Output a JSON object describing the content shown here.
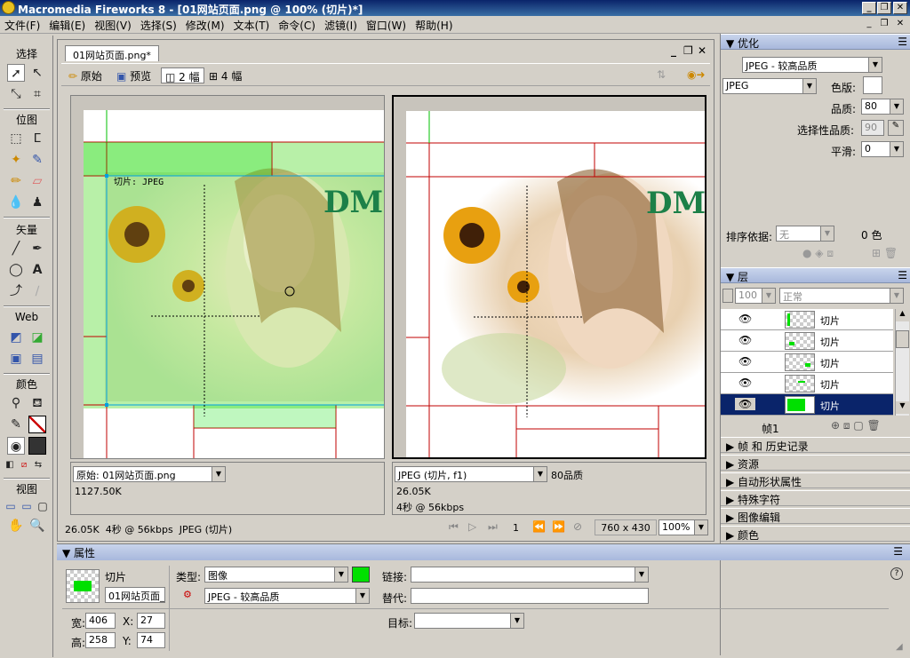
{
  "app": {
    "title": "Macromedia Fireworks 8 - [01网站页面.png @ 100% (切片)*]"
  },
  "menu": [
    "文件(F)",
    "编辑(E)",
    "视图(V)",
    "选择(S)",
    "修改(M)",
    "文本(T)",
    "命令(C)",
    "滤镜(I)",
    "窗口(W)",
    "帮助(H)"
  ],
  "tools": {
    "sections": [
      "选择",
      "位图",
      "矢量",
      "Web",
      "颜色",
      "视图"
    ]
  },
  "doc": {
    "tab": "01网站页面.png*",
    "views": {
      "original": "原始",
      "preview": "预览",
      "two_up": "2 幅",
      "four_up": "4 幅"
    },
    "left_pane": {
      "slice_label": "切片: JPEG",
      "source": "原始: 01网站页面.png",
      "size": "1127.50K"
    },
    "right_pane": {
      "format": "JPEG (切片, f1)",
      "quality": "80品质",
      "size": "26.05K",
      "time": "4秒 @ 56kbps"
    },
    "status": {
      "info": "26.05K  4秒 @ 56kbps  JPEG (切片)",
      "frame": "1",
      "dimensions": "760 x 430",
      "zoom": "100%"
    }
  },
  "optimize": {
    "title": "优化",
    "preset": "JPEG - 较高品质",
    "format": "JPEG",
    "matte_label": "色版:",
    "quality_label": "品质:",
    "quality": "80",
    "selective_label": "选择性品质:",
    "selective": "90",
    "smoothing_label": "平滑:",
    "smoothing": "0",
    "sort_label": "排序依据:",
    "sort": "无",
    "colors": "0 色"
  },
  "layers": {
    "title": "层",
    "opacity": "100",
    "blend": "正常",
    "rows": [
      "切片",
      "切片",
      "切片",
      "切片",
      "切片"
    ],
    "frame": "帧1"
  },
  "collapsed_panels": [
    "帧 和 历史记录",
    "资源",
    "自动形状属性",
    "特殊字符",
    "图像编辑",
    "颜色"
  ],
  "props": {
    "title": "属性",
    "object_type": "切片",
    "name": "01网站页面_",
    "type_label": "类型:",
    "type": "图像",
    "export": "JPEG - 较高品质",
    "link_label": "链接:",
    "link": "",
    "alt_label": "替代:",
    "alt": "",
    "target_label": "目标:",
    "target": "",
    "w_label": "宽:",
    "w": "406",
    "h_label": "高:",
    "h": "258",
    "x_label": "X:",
    "x": "27",
    "y_label": "Y:",
    "y": "74"
  },
  "colors": {
    "slice_green": "#00e000",
    "guide_red": "#c00000",
    "slice_cyan": "#00a0e0",
    "title_blue": "#0a246a"
  }
}
